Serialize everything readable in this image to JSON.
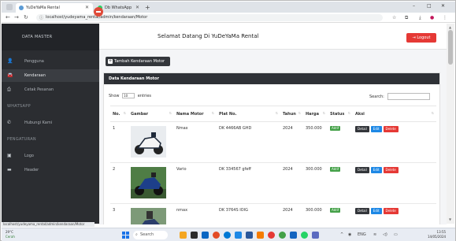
{
  "browser": {
    "tabs": [
      {
        "label": "YuDeYaMa Rental",
        "active": true,
        "color": "#5b9bd5"
      },
      {
        "label": "Db WhatsApp",
        "active": false,
        "color": "#25d366"
      }
    ],
    "new_tab": "+",
    "url": "localhost/yudeyama_rental/admin/kendaraan/Motor",
    "window_controls": [
      "–",
      "□",
      "✕"
    ]
  },
  "sidebar": {
    "title": "DATA MASTER",
    "items_data": [
      {
        "label": "Pengguna",
        "icon": "users-icon",
        "glyph": "👤"
      },
      {
        "label": "Kendaraan",
        "icon": "car-icon",
        "glyph": "🚘",
        "active": true
      },
      {
        "label": "Cetak Pesanan",
        "icon": "print-icon",
        "glyph": "⎙"
      }
    ],
    "section_whatsapp": "WHATSAPP",
    "item_whatsapp": {
      "label": "Hubungi Kami",
      "icon": "phone-icon",
      "glyph": "✆"
    },
    "section_pengaturan": "PENGATURAN",
    "items_pengaturan": [
      {
        "label": "Logo",
        "icon": "image-icon",
        "glyph": "▣"
      },
      {
        "label": "Header",
        "icon": "header-icon",
        "glyph": "▬"
      }
    ]
  },
  "status_url": "localhost/yudeyama_rental/admin/kendaraan/Motor",
  "topbar": {
    "welcome": "Selamat Datang Di YuDeYaMa Rental",
    "logout": "Logout"
  },
  "content": {
    "add_button": "Tambah Kendaraan Motor",
    "card_title": "Data Kendaraan Motor",
    "show_label": "Show",
    "show_value": "10",
    "entries_label": "entries",
    "search_label": "Search:",
    "columns": [
      "No.",
      "Gambar",
      "Nama Motor",
      "Plat No.",
      "Tahun",
      "Harga",
      "Status",
      "Aksi"
    ],
    "rows": [
      {
        "no": "1",
        "nama": "Nmax",
        "plat": "DK 4466AB GHD",
        "tahun": "2024",
        "harga": "350.000",
        "status": "Aktif",
        "img_colors": [
          "#ffffff",
          "#1f2a3a"
        ]
      },
      {
        "no": "2",
        "nama": "Vario",
        "plat": "DK 334567 gfeff",
        "tahun": "2024",
        "harga": "300.000",
        "status": "Aktif",
        "img_colors": [
          "#3f7a3a",
          "#1d3f8a"
        ]
      },
      {
        "no": "3",
        "nama": "nmax",
        "plat": "DK 3764S IOIG",
        "tahun": "2024",
        "harga": "300.000",
        "status": "Aktif",
        "img_colors": [
          "#6f8f6a",
          "#2a3d6b"
        ]
      }
    ],
    "actions": {
      "detail": "Detail",
      "edit": "Edit",
      "delete": "Delete"
    }
  },
  "taskbar": {
    "weather_temp": "29°C",
    "weather_desc": "Cerah",
    "search": "Search",
    "clock_time": "13:55",
    "clock_date": "14/05/2024",
    "lang": "ENG"
  },
  "colors": {
    "sidebar_bg": "#2b2d31",
    "accent_red": "#e53935",
    "status_green": "#43a047",
    "edit_blue": "#1e88e5"
  }
}
